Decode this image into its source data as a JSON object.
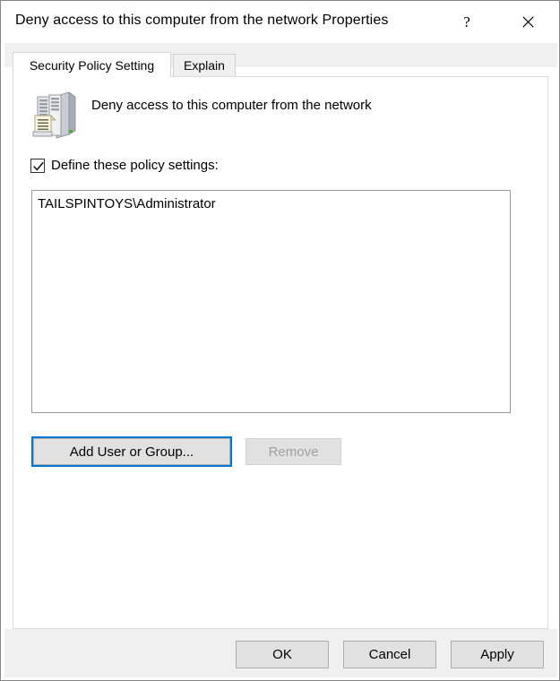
{
  "window": {
    "title": "Deny access to this computer from the network Properties",
    "help_glyph": "?",
    "help_name": "help-button",
    "close_name": "close-button"
  },
  "tabs": [
    {
      "label": "Security Policy Setting",
      "active": true
    },
    {
      "label": "Explain",
      "active": false
    }
  ],
  "policy": {
    "icon_name": "security-policy-server-icon",
    "heading": "Deny access to this computer from the network",
    "define_checkbox": {
      "label": "Define these policy settings:",
      "checked": true
    },
    "members": [
      "TAILSPINTOYS\\Administrator"
    ],
    "buttons": {
      "add": "Add User or Group...",
      "remove": "Remove"
    }
  },
  "footer": {
    "ok": "OK",
    "cancel": "Cancel",
    "apply": "Apply"
  },
  "colors": {
    "accent_focus": "#0078d7",
    "dialog_bg": "#ffffff",
    "footer_bg": "#f0f0f0",
    "button_face": "#e1e1e1",
    "disabled_text": "#a0a0a0"
  }
}
